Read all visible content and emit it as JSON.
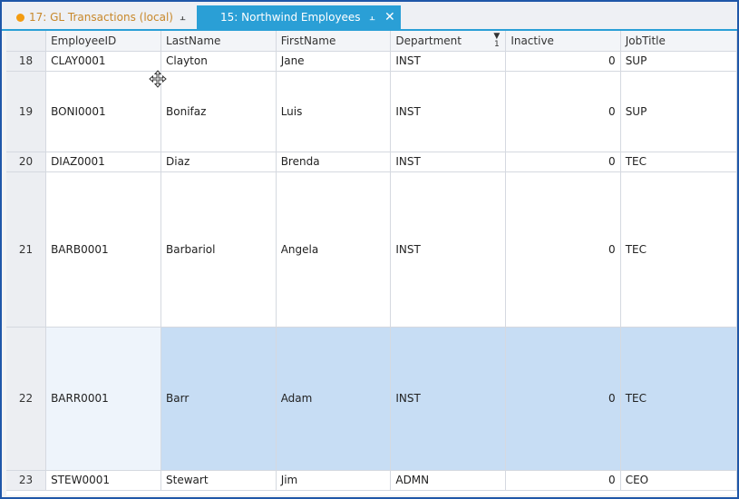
{
  "tabs": [
    {
      "label": "17: GL Transactions (local)",
      "active": false,
      "dot_color": "#f39c12"
    },
    {
      "label": "15: Northwind Employees",
      "active": true
    }
  ],
  "icons": {
    "pin": "⫠",
    "close": "✕",
    "filter_count": "1"
  },
  "grid": {
    "columns": [
      "",
      "EmployeeID",
      "LastName",
      "FirstName",
      "Department",
      "Inactive",
      "JobTitle"
    ],
    "rows": [
      {
        "num": "18",
        "id": "CLAY0001",
        "last": "Clayton",
        "first": "Jane",
        "dept": "INST",
        "inactive": "0",
        "job": "SUP"
      },
      {
        "num": "19",
        "id": "BONI0001",
        "last": "Bonifaz",
        "first": "Luis",
        "dept": "INST",
        "inactive": "0",
        "job": "SUP"
      },
      {
        "num": "20",
        "id": "DIAZ0001",
        "last": "Diaz",
        "first": "Brenda",
        "dept": "INST",
        "inactive": "0",
        "job": "TEC"
      },
      {
        "num": "21",
        "id": "BARB0001",
        "last": "Barbariol",
        "first": "Angela",
        "dept": "INST",
        "inactive": "0",
        "job": "TEC"
      },
      {
        "num": "22",
        "id": "BARR0001",
        "last": "Barr",
        "first": "Adam",
        "dept": "INST",
        "inactive": "0",
        "job": "TEC"
      },
      {
        "num": "23",
        "id": "STEW0001",
        "last": "Stewart",
        "first": "Jim",
        "dept": "ADMN",
        "inactive": "0",
        "job": "CEO"
      }
    ],
    "selected_row": "22",
    "colors": {
      "selection": "#c7ddf4",
      "accent": "#2a9fd6"
    }
  }
}
